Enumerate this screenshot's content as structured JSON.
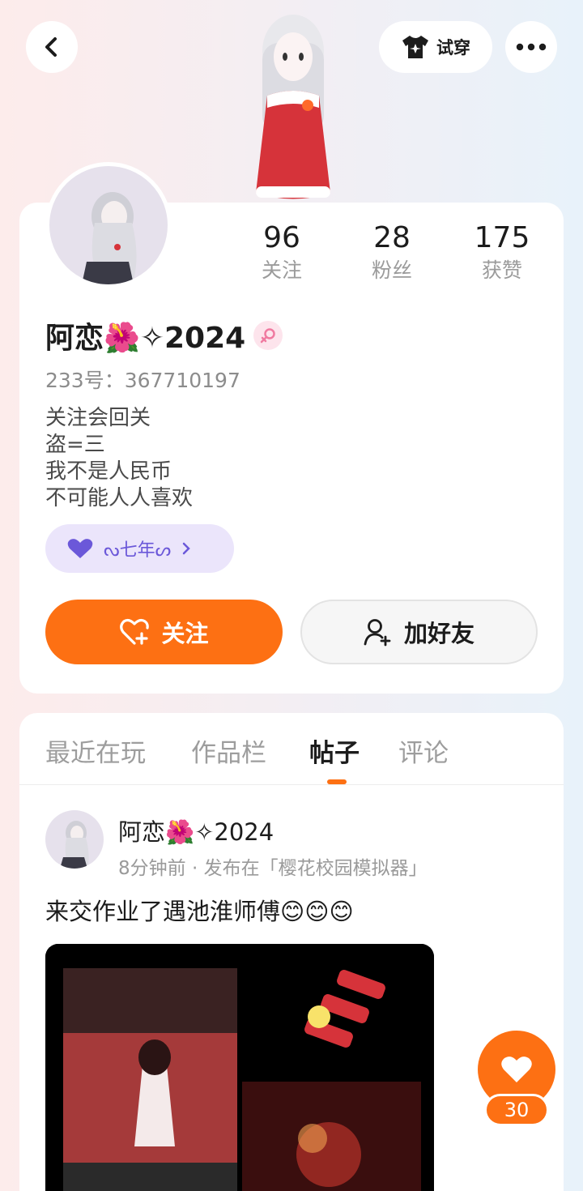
{
  "header": {
    "back_icon": "chevron-left-icon",
    "tryon_label": "试穿",
    "tryon_icon": "shirt-icon",
    "more_icon": "more-dots-icon"
  },
  "profile": {
    "stats": [
      {
        "value": "96",
        "label": "关注"
      },
      {
        "value": "28",
        "label": "粉丝"
      },
      {
        "value": "175",
        "label": "获赞"
      }
    ],
    "name": "阿恋🌺✧2024",
    "gender_icon": "female-icon",
    "uid": "233号：367710197",
    "bio": [
      "关注会回关",
      "盗=三",
      "我不是人民币",
      "不可能人人喜欢"
    ],
    "guard_label": "ᔓ七年ᔕ",
    "follow_label": "关注",
    "add_friend_label": "加好友"
  },
  "tabs": [
    {
      "label": "最近在玩",
      "active": false
    },
    {
      "label": "作品栏",
      "active": false
    },
    {
      "label": "帖子",
      "active": true
    },
    {
      "label": "评论",
      "active": false
    }
  ],
  "post": {
    "author": "阿恋🌺✧2024",
    "meta": "8分钟前 · 发布在「樱花校园模拟器」",
    "text": "来交作业了遇池淮师傅😊😊😊",
    "like_count": "30"
  },
  "colors": {
    "accent": "#fd7013",
    "guard": "#6b58d9"
  }
}
